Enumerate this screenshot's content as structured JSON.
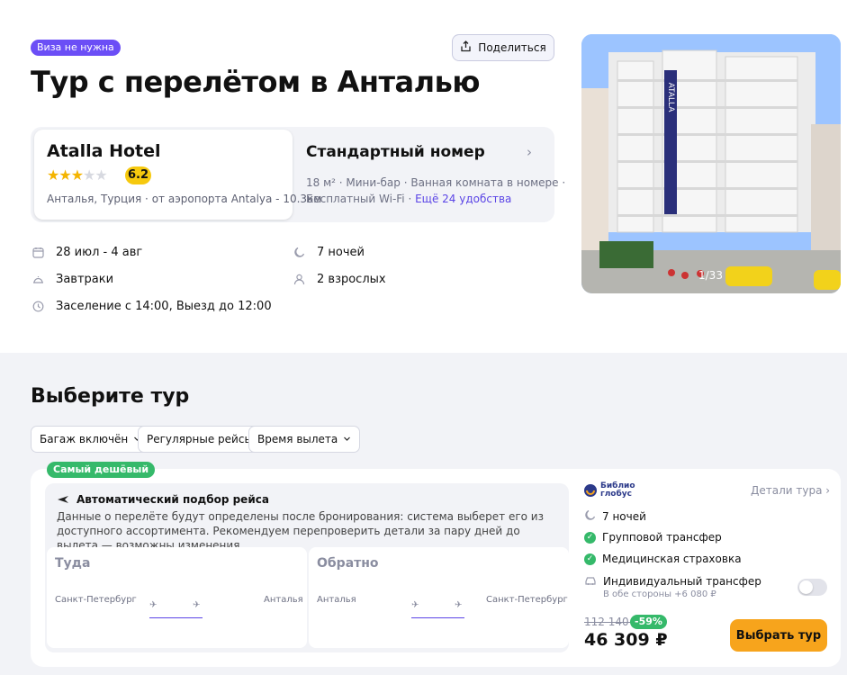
{
  "header": {
    "visa_badge": "Виза не нужна",
    "share_label": "Поделиться",
    "title": "Тур с перелётом в Анталью"
  },
  "hotel": {
    "name": "Atalla Hotel",
    "stars": 3,
    "stars_max": 5,
    "rating": "6.2",
    "location": "Анталья, Турция",
    "airport_distance": "от аэропорта Antalya - 10.3км"
  },
  "room": {
    "title": "Стандартный номер",
    "amenities_line1": [
      "18 м²",
      "Мини-бар",
      "Ванная комната в номере"
    ],
    "amenities_line2_item": "Бесплатный Wi-Fi",
    "more_amenities": "Ещё 24 удобства"
  },
  "details": {
    "dates": "28 июл - 4 авг",
    "nights": "7 ночей",
    "meals": "Завтраки",
    "guests": "2 взрослых",
    "checkin": "Заселение с 14:00, Выезд до 12:00"
  },
  "photo": {
    "counter": "1/33",
    "sign_text": "ATALLA"
  },
  "tour_section": {
    "title": "Выберите тур",
    "filters": [
      "Багаж включён",
      "Регулярные рейсы",
      "Время вылета"
    ]
  },
  "tour_card": {
    "cheap_badge": "Самый дешёвый",
    "auto_title": "Автоматический подбор рейса",
    "auto_desc": "Данные о перелёте будут определены после бронирования: система выберет его из доступного ассортимента. Рекомендуем перепроверить детали за пару дней до вылета — возможны изменения.",
    "out": {
      "title": "Туда",
      "from": "Санкт-Петербург",
      "to": "Анталья"
    },
    "back": {
      "title": "Обратно",
      "from": "Анталья",
      "to": "Санкт-Петербург"
    },
    "operator_line1": "Библио",
    "operator_line2": "глобус",
    "details_link": "Детали тура",
    "nights": "7 ночей",
    "transfer": "Групповой трансфер",
    "insurance": "Медицинская страховка",
    "individual_transfer": "Индивидуальный трансфер",
    "individual_transfer_note": "В обе стороны +6 080 ₽",
    "individual_transfer_enabled": false,
    "old_price": "112 140 ₽",
    "discount": "-59%",
    "price": "46 309 ₽",
    "choose_label": "Выбрать тур"
  },
  "colors": {
    "accent": "#5b45e6",
    "visa_badge": "#6b4ef6",
    "success": "#35b96a",
    "rating": "#f6c90e",
    "cta": "#f7a41c",
    "background_section": "#f2f3f7"
  }
}
